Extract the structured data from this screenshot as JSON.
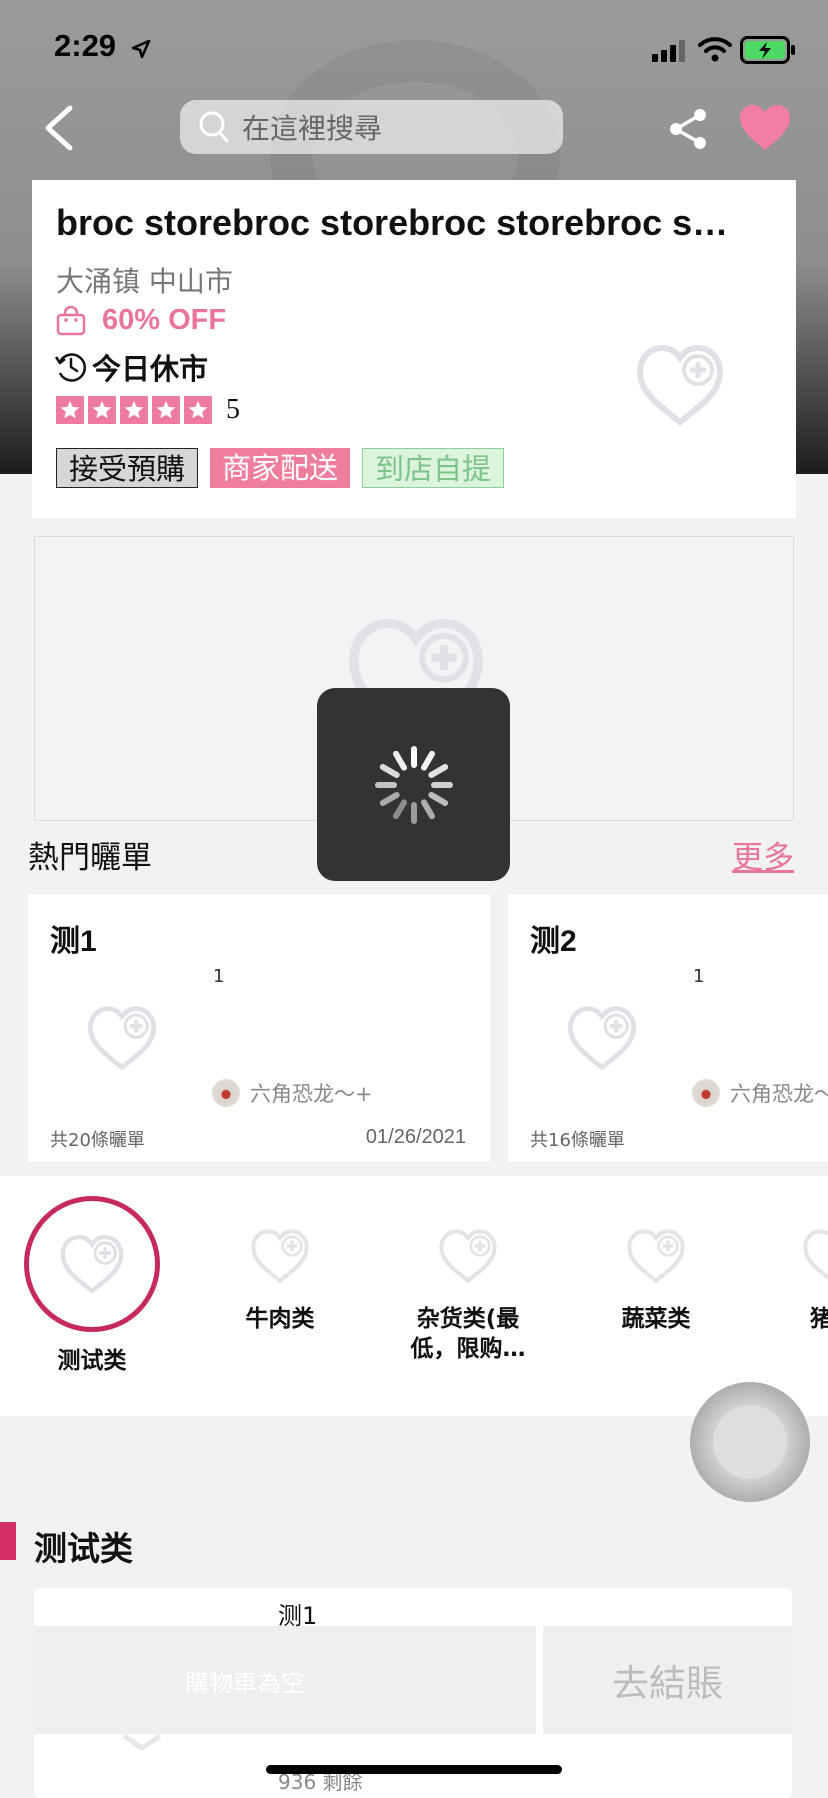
{
  "status": {
    "time": "2:29"
  },
  "header": {
    "search_placeholder": "在這裡搜尋",
    "icons": [
      "back-arrow-icon",
      "search-icon",
      "share-icon",
      "favorite-heart-icon"
    ]
  },
  "store": {
    "name": "broc storebroc storebroc storebroc storebroc",
    "location": "大涌镇 中山市",
    "discount": "60% OFF",
    "status": "今日休市",
    "rating": "5",
    "rating_stars": 5,
    "tags": [
      "接受預購",
      "商家配送",
      "到店自提"
    ]
  },
  "hot_posts": {
    "title": "熱門曬單",
    "more": "更多",
    "items": [
      {
        "title": "测1",
        "num": "1",
        "author": "六角恐龙～+",
        "count": "共20條曬單",
        "date": "01/26/2021"
      },
      {
        "title": "测2",
        "num": "1",
        "author": "六角恐龙～+",
        "count": "共16條曬單",
        "date": ""
      }
    ]
  },
  "categories": [
    {
      "label": "测试类",
      "selected": true
    },
    {
      "label": "牛肉类"
    },
    {
      "label": "杂货类(最低，限购…"
    },
    {
      "label": "蔬菜类"
    },
    {
      "label": "猪"
    }
  ],
  "section": {
    "title": "测试类",
    "product_name": "测1",
    "product_remaining": "936 剩餘"
  },
  "cart": {
    "empty_label": "購物車為空",
    "checkout_label": "去結賬"
  },
  "colors": {
    "accent_pink": "#e9749c",
    "category_ring": "#c62a5c",
    "delivery_tag": "#ef7d9e",
    "pickup_tag": "#7cc48a"
  }
}
